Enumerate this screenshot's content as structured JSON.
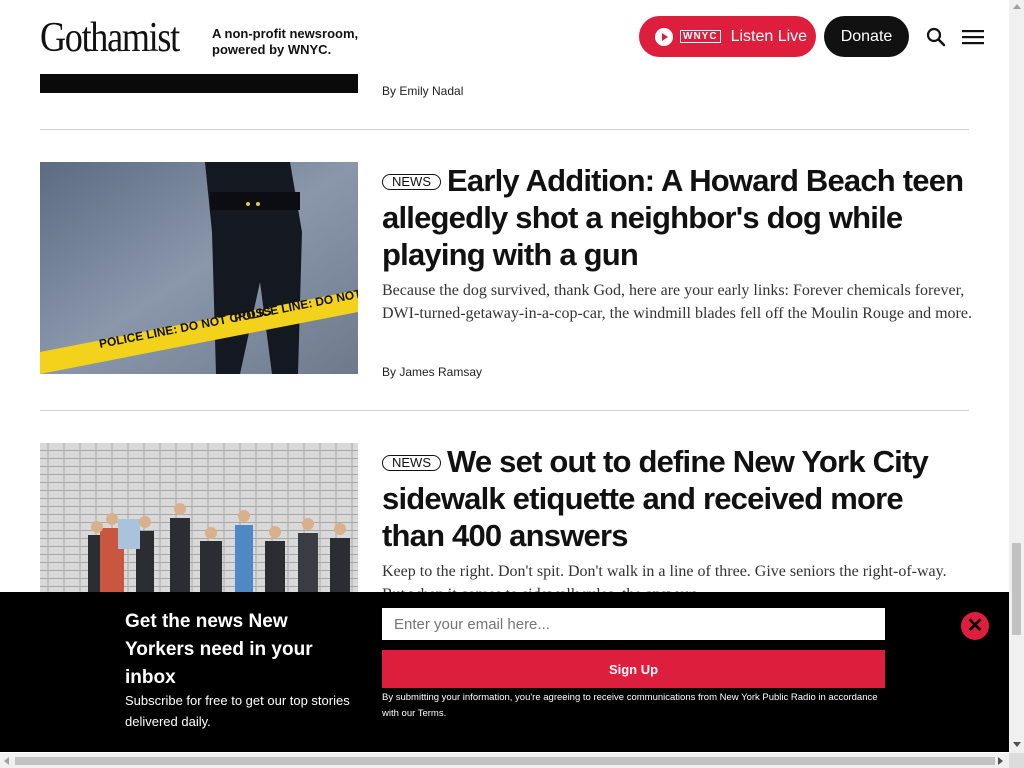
{
  "header": {
    "logo": "Gothamist",
    "tagline_line1": "A non-profit newsroom,",
    "tagline_line2": "powered by WNYC.",
    "wnyc_label": "WNYC",
    "listen_label": "Listen Live",
    "donate_label": "Donate",
    "accent_color": "#de1e3d"
  },
  "articles": [
    {
      "byline": "By Emily Nadal"
    },
    {
      "tag": "NEWS",
      "headline": "Early Addition: A Howard Beach teen allegedly shot a neighbor's dog while playing with a gun",
      "summary": "Because the dog survived, thank God, here are your early links: Forever chemicals forever, DWI-turned-getaway-in-a-cop-car, the windmill blades fell off the Moulin Rouge and more.",
      "byline": "By James Ramsay",
      "image_alt": "police-tape-photo"
    },
    {
      "tag": "NEWS",
      "headline": "We set out to define New York City sidewalk etiquette and received more than 400 answers",
      "summary": "Keep to the right. Don't spit. Don't walk in a line of three. Give seniors the right-of-way. But when it comes to sidewalk rules, the answers ...",
      "image_alt": "pedestrians-on-sidewalk-photo"
    }
  ],
  "newsletter": {
    "heading": "Get the news New Yorkers need in your inbox",
    "subtext": "Subscribe for free to get our top stories delivered daily.",
    "email_placeholder": "Enter your email here...",
    "signup_label": "Sign Up",
    "disclaimer": "By submitting your information, you're agreeing to receive communications from New York Public Radio in accordance with our Terms.",
    "close_icon": "close-icon"
  }
}
